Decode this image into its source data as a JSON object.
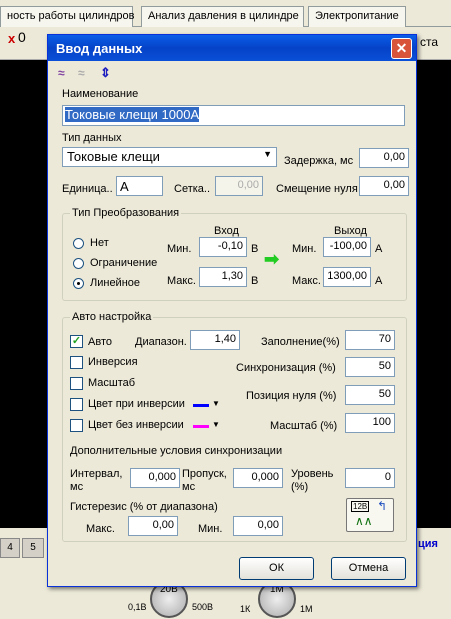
{
  "background": {
    "tabs": [
      "ность работы цилиндров",
      "Анализ давления в цилиндре",
      "Электропитание"
    ],
    "toolbar_text": "ста",
    "toolbar_num": "0",
    "page_buttons": [
      "4",
      "5"
    ],
    "right_label": "ция",
    "knob1": {
      "label": "20В",
      "min": "0,1В",
      "max": "500В"
    },
    "knob2": {
      "label": "1М",
      "min": "1К",
      "max": "1М"
    }
  },
  "dialog": {
    "title": "Ввод данных",
    "name_label": "Наименование",
    "name_value": "Токовые клещи 1000А",
    "type_label": "Тип данных",
    "type_value": "Токовые клещи",
    "delay_label": "Задержка, мс",
    "delay_value": "0,00",
    "unit_label": "Единица..",
    "unit_value": "А",
    "grid_label": "Сетка..",
    "grid_value": "0,00",
    "zero_shift_label": "Смещение нуля",
    "zero_shift_value": "0,00",
    "conv": {
      "title": "Тип Преобразования",
      "opt_none": "Нет",
      "opt_limit": "Ограничение",
      "opt_linear": "Линейное",
      "in_label": "Вход",
      "out_label": "Выход",
      "min_label": "Мин.",
      "max_label": "Макс.",
      "in_min": "-0,10",
      "in_max": "1,30",
      "in_unit": "В",
      "out_min": "-100,00",
      "out_max": "1300,00",
      "out_unit": "А"
    },
    "auto": {
      "title": "Авто настройка",
      "auto_label": "Авто",
      "auto_checked": true,
      "range_label": "Диапазон.",
      "range_value": "1,40",
      "fill_label": "Заполнение(%)",
      "fill_value": "70",
      "inversion_label": "Инверсия",
      "sync_label": "Синхронизация (%)",
      "sync_value": "50",
      "scale_label": "Масштаб",
      "zero_pos_label": "Позиция нуля (%)",
      "zero_pos_value": "50",
      "color_inv_label": "Цвет при инверсии",
      "color_inv": "#0000ff",
      "color_noinv_label": "Цвет без инверсии",
      "color_noinv": "#ff00ff",
      "scale_pct_label": "Масштаб (%)",
      "scale_pct_value": "100"
    },
    "sync": {
      "title": "Дополнительные условия синхронизации",
      "interval_label": "Интервал,",
      "interval_unit": "мс",
      "interval_value": "0,000",
      "skip_label": "Пропуск,",
      "skip_unit": "мс",
      "skip_value": "0,000",
      "level_label": "Уровень",
      "level_unit": "(%)",
      "level_value": "0",
      "hyst_label": "Гистерезис (% от диапазона)",
      "hmax_label": "Макс.",
      "hmax_value": "0,00",
      "hmin_label": "Мин.",
      "hmin_value": "0,00"
    },
    "ok_label": "ОК",
    "cancel_label": "Отмена"
  }
}
